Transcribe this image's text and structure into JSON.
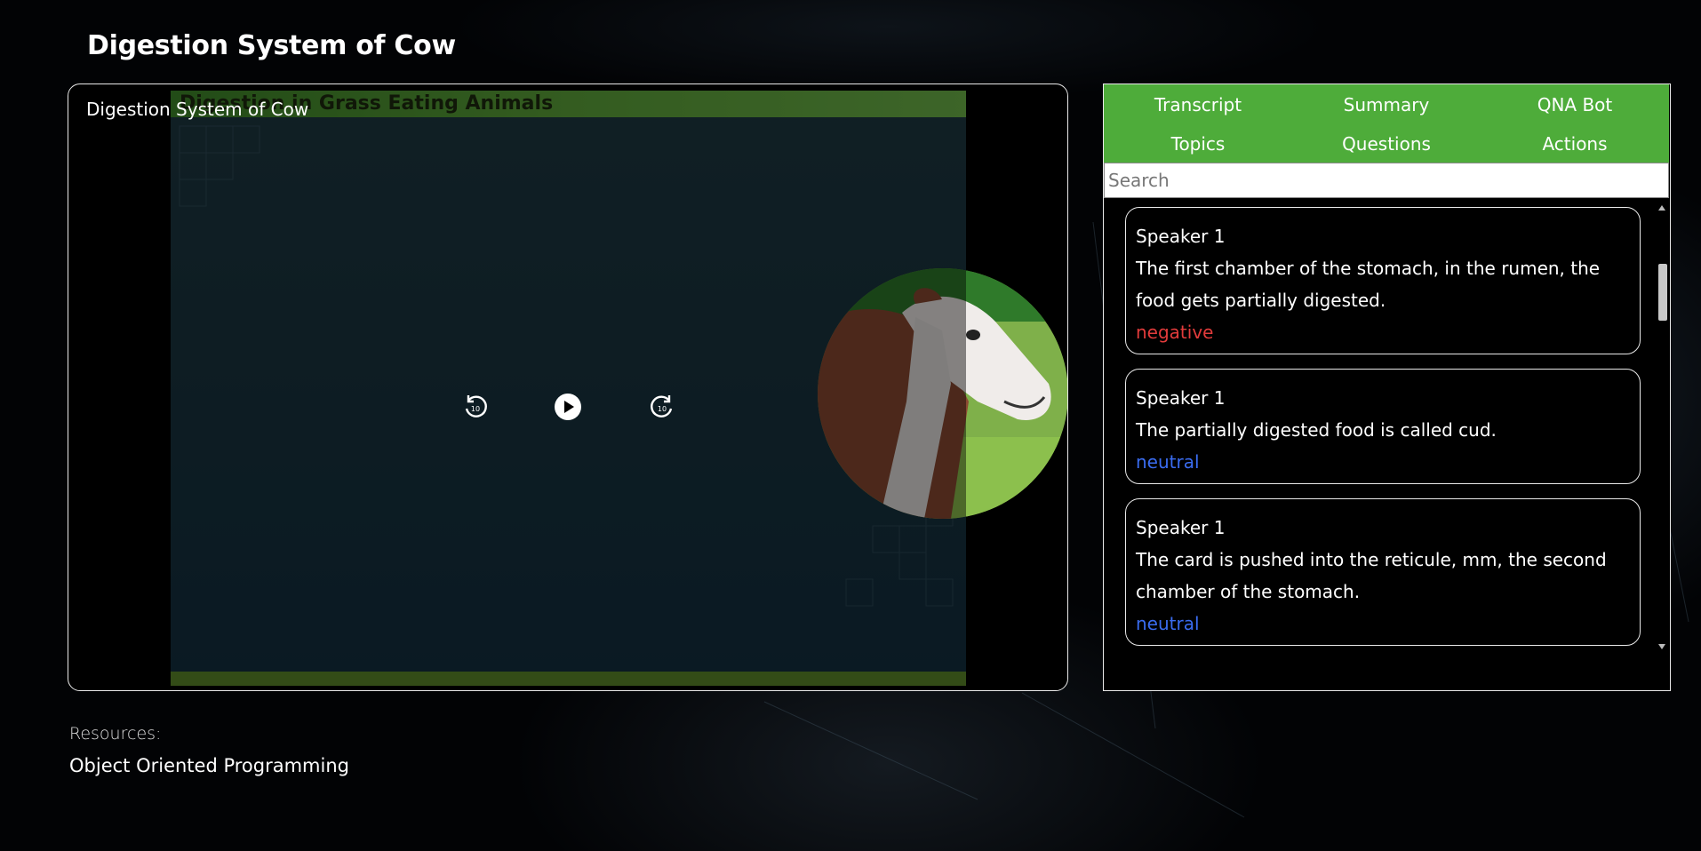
{
  "page": {
    "title": "Digestion System of Cow"
  },
  "video": {
    "title": "Digestion System of Cow",
    "slide_heading": "Digestion in Grass Eating Animals",
    "controls": {
      "rewind_icon": "replay-10-icon",
      "play_icon": "play-icon",
      "forward_icon": "forward-10-icon",
      "skip_seconds": "10"
    }
  },
  "panel": {
    "accent_color": "#4eac3a",
    "tabs": [
      {
        "label": "Transcript"
      },
      {
        "label": "Summary"
      },
      {
        "label": "QNA Bot"
      },
      {
        "label": "Topics"
      },
      {
        "label": "Questions"
      },
      {
        "label": "Actions"
      }
    ],
    "search": {
      "placeholder": "Search",
      "value": ""
    },
    "transcript": [
      {
        "speaker": "Speaker 1",
        "text": "The first chamber of the stomach, in the rumen, the food gets partially digested.",
        "sentiment": "negative",
        "sentiment_color": "#e23b3b"
      },
      {
        "speaker": "Speaker 1",
        "text": "The partially digested food is called cud.",
        "sentiment": "neutral",
        "sentiment_color": "#3a6cf0"
      },
      {
        "speaker": "Speaker 1",
        "text": "The card is pushed into the reticule, mm, the second chamber of the stomach.",
        "sentiment": "neutral",
        "sentiment_color": "#3a6cf0"
      }
    ]
  },
  "resources": {
    "label": "Resources:",
    "items": [
      {
        "label": "Object Oriented Programming"
      }
    ]
  }
}
